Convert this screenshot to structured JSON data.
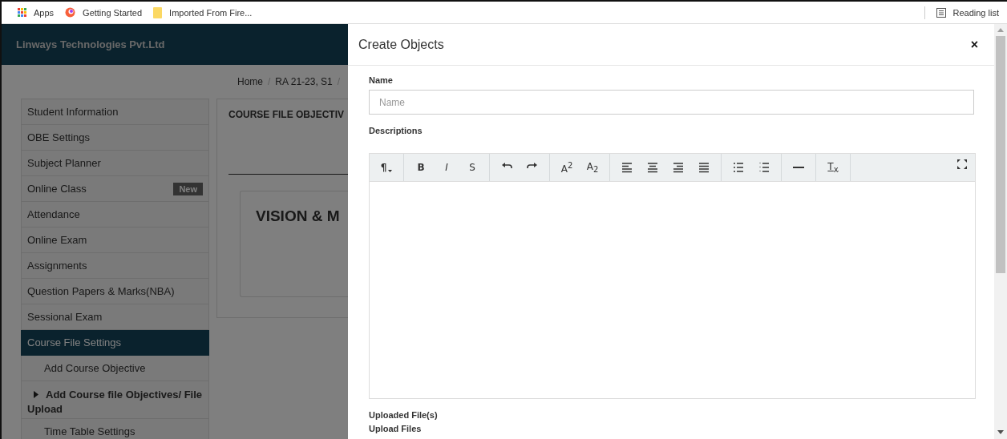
{
  "bookmarks_bar": {
    "items": [
      {
        "label": "Apps",
        "kind": "apps"
      },
      {
        "label": "Getting Started",
        "kind": "browser"
      },
      {
        "label": "Imported From Fire...",
        "kind": "folder"
      }
    ],
    "reading_list": "Reading list"
  },
  "header": {
    "brand": "Linways Technologies Pvt.Ltd"
  },
  "breadcrumb": {
    "items": [
      "Home",
      "RA 21-23, S1"
    ],
    "separator": "/"
  },
  "sidebar": {
    "items": [
      {
        "label": "Student Information",
        "selected": false
      },
      {
        "label": "OBE Settings",
        "selected": false
      },
      {
        "label": "Subject Planner",
        "selected": false
      },
      {
        "label": "Online Class",
        "selected": false,
        "badge": "New"
      },
      {
        "label": "Attendance",
        "selected": false
      },
      {
        "label": "Online Exam",
        "selected": false
      },
      {
        "label": "Assignments",
        "selected": false
      },
      {
        "label": "Question Papers & Marks(NBA)",
        "selected": false
      },
      {
        "label": "Sessional Exam",
        "selected": false
      },
      {
        "label": "Course File Settings",
        "selected": true,
        "children": [
          {
            "label": "Add Course Objective",
            "kind": "link"
          },
          {
            "label": "Add Course file Objectives/ File Upload",
            "kind": "group",
            "expanded": false
          },
          {
            "label": "Time Table Settings",
            "kind": "link"
          }
        ]
      }
    ]
  },
  "panel": {
    "title": "COURSE FILE OBJECTIV",
    "card_title": "VISION & M"
  },
  "modal": {
    "title": "Create Objects",
    "close": "×",
    "name_label": "Name",
    "name_placeholder": "Name",
    "descriptions_label": "Descriptions",
    "toolbar": [
      [
        {
          "kind": "paragraph",
          "label": "¶"
        }
      ],
      [
        {
          "kind": "bold",
          "label": "B"
        },
        {
          "kind": "italic",
          "label": "I"
        },
        {
          "kind": "strike",
          "label": "S"
        }
      ],
      [
        {
          "kind": "undo"
        },
        {
          "kind": "redo"
        }
      ],
      [
        {
          "kind": "superscript",
          "label": "A$^{2}$"
        },
        {
          "kind": "subscript",
          "label": "A$_{2}$"
        }
      ],
      [
        {
          "kind": "align-left"
        },
        {
          "kind": "align-center"
        },
        {
          "kind": "align-right"
        },
        {
          "kind": "justify"
        }
      ],
      [
        {
          "kind": "bullet-list"
        },
        {
          "kind": "numbered-list"
        }
      ],
      [
        {
          "kind": "rule"
        }
      ],
      [
        {
          "kind": "clear",
          "label": "T$_{x}$"
        }
      ]
    ],
    "uploaded_label": "Uploaded File(s)",
    "upload_label": "Upload Files"
  }
}
